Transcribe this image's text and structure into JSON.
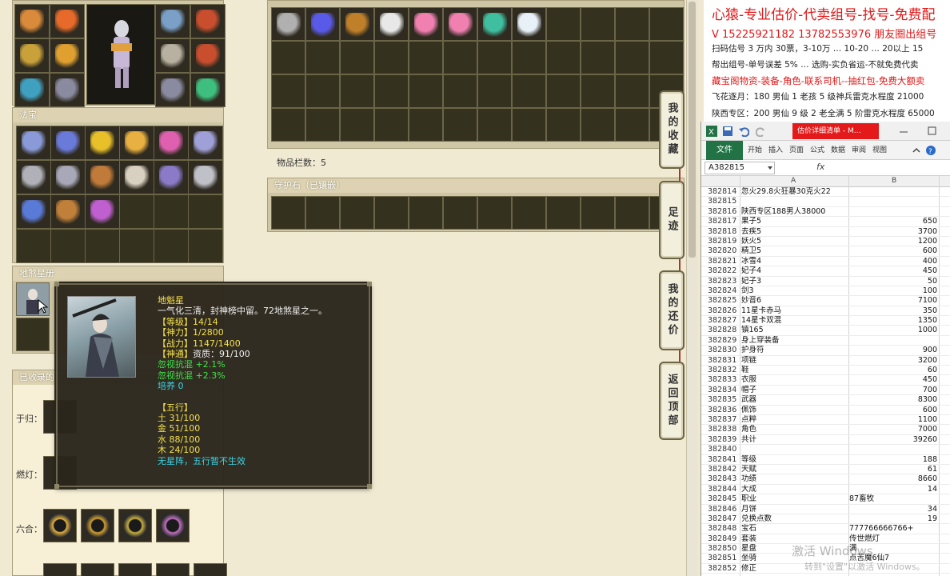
{
  "game": {
    "fabao_label": "法宝",
    "disha_label": "地煞星册",
    "collected_label": "已收录的",
    "bag_count": "物品栏数：5",
    "guard_label": "守护石（已镶嵌）",
    "rows": [
      {
        "label": "于归："
      },
      {
        "label": "燃灯："
      },
      {
        "label": "六合："
      }
    ],
    "side_tabs": [
      {
        "label": "我的收藏"
      },
      {
        "label": "足迹"
      },
      {
        "label": "我的还价"
      },
      {
        "label": "返回顶部"
      }
    ],
    "equip_colors": [
      "#d98a3a",
      "#e76a2a",
      "#c9a13a",
      "#e0a030",
      "#7aa0c8",
      "#c94e2e",
      "#3fa0c0",
      "#8a8aa0",
      "#b8b0a0",
      "#3fbf7f"
    ],
    "fabao_colors": [
      "#8a9ad8",
      "#6a7ad8",
      "#e8c02a",
      "#e8b040",
      "#e060b0",
      "#a0a0d8",
      "#b0b0b8",
      "#a8a8b8",
      "#c07a3a",
      "#d8d0c0",
      "#8a7ac8",
      "#c0c0c8",
      "#5a7ad8",
      "#c0803a",
      "#c060d0"
    ],
    "bag_colors": [
      "#b0b0b0",
      "#5a5ae8",
      "#c0802a",
      "#e8e8e8",
      "#f080b0",
      "#f080b0",
      "#3fbf9f",
      "#e8f0f8"
    ]
  },
  "tooltip": {
    "name": "地魁星",
    "desc": "一气化三清，封神榜中留。72地煞星之一。",
    "stats": [
      {
        "k": "【等级】",
        "v": "14/14"
      },
      {
        "k": "【神力】",
        "v": "1/2800"
      },
      {
        "k": "【战力】",
        "v": "1147/1400"
      },
      {
        "k": "【神通】",
        "v": "资质：91/100"
      }
    ],
    "resist1": "忽视抗混 +2.1%",
    "resist2": "忽视抗混 +2.3%",
    "cultivate": "培养 0",
    "wuxing_title": "【五行】",
    "wuxing": [
      "土 31/100",
      "金 51/100",
      "水 88/100",
      "木 24/100"
    ],
    "no_array": "无星阵，五行暂不生效"
  },
  "ad": {
    "line1": "心猿-专业估价-代卖组号-找号-免费配",
    "line2": "V 15225921182   13782553976 朋友圈出组号",
    "line3": "扫码估号 3 万内 30票，3-10万 … 10-20 … 20以上 15",
    "line4": "帮出组号-单号误差 5% … 选购-实负省运-不就免费代卖",
    "line5": "藏宝阁物资-装备-角色-联系司机--抽红包-免费大额卖",
    "line6": "飞花逐月：180 男仙 1 老孩 5 级神兵雷克水程度 21000",
    "line7": "陕西专区：200 男仙 9 级 2 老全满 5 阶雷克水程度 65000"
  },
  "excel": {
    "title": "估价详细清单 - M…",
    "file_tab": "文件",
    "tabs": [
      "开始",
      "插入",
      "页面",
      "公式",
      "数据",
      "审阅",
      "视图"
    ],
    "namebox": "A382815",
    "fx": "fx",
    "col_a": "A",
    "col_b": "B",
    "rows": [
      {
        "n": "382814",
        "a": "忽火29.8火狂暴30克火22",
        "b": ""
      },
      {
        "n": "382815",
        "a": "",
        "b": ""
      },
      {
        "n": "382816",
        "a": "陕西专区188男人38000",
        "b": ""
      },
      {
        "n": "382817",
        "a": "果子5",
        "b": "650"
      },
      {
        "n": "382818",
        "a": "去疾5",
        "b": "3700"
      },
      {
        "n": "382819",
        "a": "妖火5",
        "b": "1200"
      },
      {
        "n": "382820",
        "a": "精卫5",
        "b": "600"
      },
      {
        "n": "382821",
        "a": "冰雪4",
        "b": "400"
      },
      {
        "n": "382822",
        "a": "妃子4",
        "b": "450"
      },
      {
        "n": "382823",
        "a": "妃子3",
        "b": "50"
      },
      {
        "n": "382824",
        "a": "剑3",
        "b": "100"
      },
      {
        "n": "382825",
        "a": "妙音6",
        "b": "7100"
      },
      {
        "n": "382826",
        "a": "11星卡赤马",
        "b": "350"
      },
      {
        "n": "382827",
        "a": "14星卡双混",
        "b": "1350"
      },
      {
        "n": "382828",
        "a": "镇165",
        "b": "1000"
      },
      {
        "n": "382829",
        "a": "身上穿装备",
        "b": ""
      },
      {
        "n": "382830",
        "a": "护身符",
        "b": "900"
      },
      {
        "n": "382831",
        "a": "项链",
        "b": "3200"
      },
      {
        "n": "382832",
        "a": "鞋",
        "b": "60"
      },
      {
        "n": "382833",
        "a": "衣服",
        "b": "450"
      },
      {
        "n": "382834",
        "a": "帽子",
        "b": "700"
      },
      {
        "n": "382835",
        "a": "武器",
        "b": "8300"
      },
      {
        "n": "382836",
        "a": "佩饰",
        "b": "600"
      },
      {
        "n": "382837",
        "a": "点粹",
        "b": "1100"
      },
      {
        "n": "382838",
        "a": "角色",
        "b": "7000"
      },
      {
        "n": "382839",
        "a": "共计",
        "b": "39260"
      },
      {
        "n": "382840",
        "a": "",
        "b": ""
      },
      {
        "n": "382841",
        "a": "等级",
        "b": "188"
      },
      {
        "n": "382842",
        "a": "天赋",
        "b": "61"
      },
      {
        "n": "382843",
        "a": "功绩",
        "b": "8660"
      },
      {
        "n": "382844",
        "a": "大成",
        "b": "14"
      },
      {
        "n": "382845",
        "a": "职业",
        "b": "87畜牧",
        "txt": true
      },
      {
        "n": "382846",
        "a": "月饼",
        "b": "34"
      },
      {
        "n": "382847",
        "a": "兑换点数",
        "b": "19"
      },
      {
        "n": "382848",
        "a": "宝石",
        "b": "777766666766+",
        "txt": true
      },
      {
        "n": "382849",
        "a": "套装",
        "b": "传世燃灯",
        "txt": true
      },
      {
        "n": "382850",
        "a": "星盘",
        "b": "满",
        "txt": true
      },
      {
        "n": "382851",
        "a": "坐骑",
        "b": "点苦魔6仙7",
        "txt": true
      },
      {
        "n": "382852",
        "a": "修正",
        "b": "",
        "txt": true
      }
    ]
  },
  "watermark": {
    "line1": "激活 Windows",
    "line2": "转到\"设置\"以激活 Windows。"
  }
}
